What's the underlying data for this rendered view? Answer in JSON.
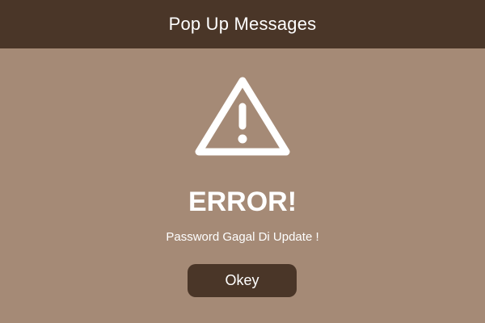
{
  "header": {
    "title": "Pop Up Messages"
  },
  "dialog": {
    "icon": "warning-triangle-icon",
    "heading": "ERROR!",
    "message": "Password Gagal Di Update !",
    "ok_label": "Okey"
  },
  "colors": {
    "background": "#a58a76",
    "header_bg": "#4a3628",
    "button_bg": "#4a3628",
    "text": "#ffffff"
  }
}
